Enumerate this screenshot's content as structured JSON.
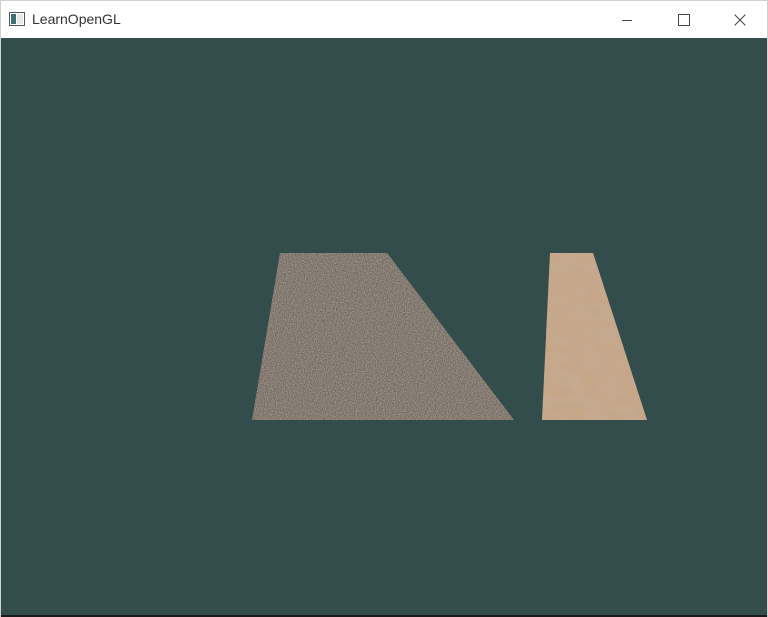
{
  "window": {
    "title": "LearnOpenGL",
    "controls": {
      "minimize": "minimize-icon",
      "maximize": "maximize-icon",
      "close": "close-icon"
    }
  },
  "viewport": {
    "clear_color": "#334d4d",
    "objects": [
      {
        "name": "marble-quad",
        "texture_colors": [
          "#5a5048",
          "#7a6e62",
          "#3e362f",
          "#8e8478"
        ]
      },
      {
        "name": "container-quad",
        "texture_colors": [
          "#c9a98a",
          "#b08b6c",
          "#e2c9ae",
          "#8a6a52"
        ]
      }
    ]
  }
}
